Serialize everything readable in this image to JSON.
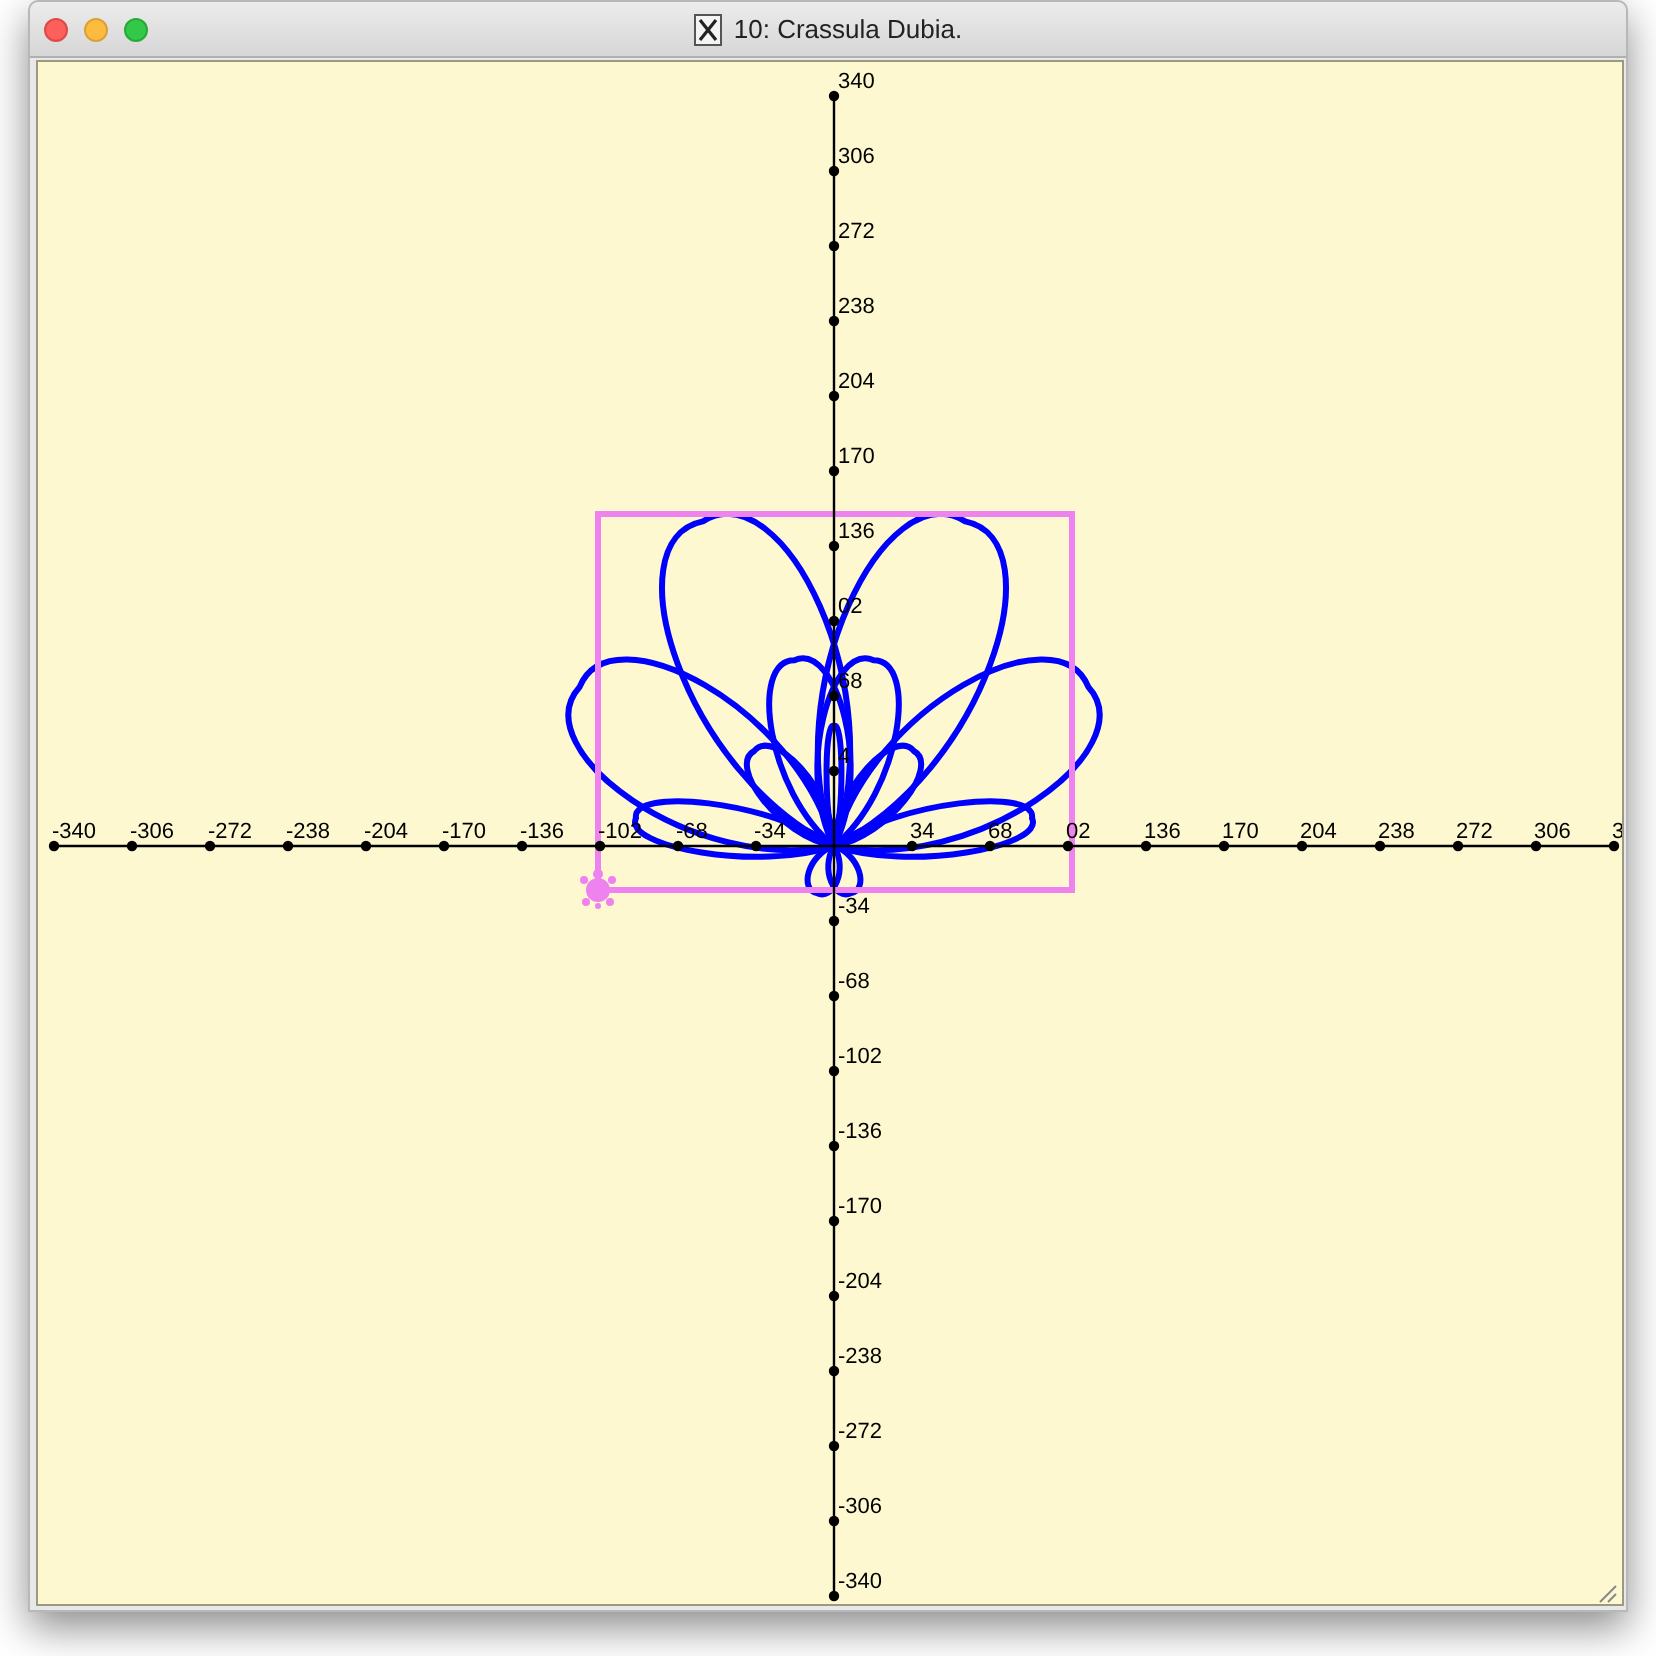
{
  "window": {
    "title": "10: Crassula Dubia."
  },
  "plot": {
    "x_axis": {
      "tick_labels": [
        "-340",
        "-306",
        "-272",
        "-238",
        "-204",
        "-170",
        "-136",
        "-102",
        "-68",
        "-34",
        "34",
        "68",
        "02",
        "136",
        "170",
        "204",
        "238",
        "272",
        "306",
        "3"
      ]
    },
    "y_axis": {
      "tick_labels": [
        "340",
        "306",
        "272",
        "238",
        "204",
        "170",
        "136",
        "02",
        "68",
        "4",
        "-34",
        "-68",
        "-102",
        "-136",
        "-170",
        "-204",
        "-238",
        "-272",
        "-306",
        "-340"
      ]
    }
  }
}
